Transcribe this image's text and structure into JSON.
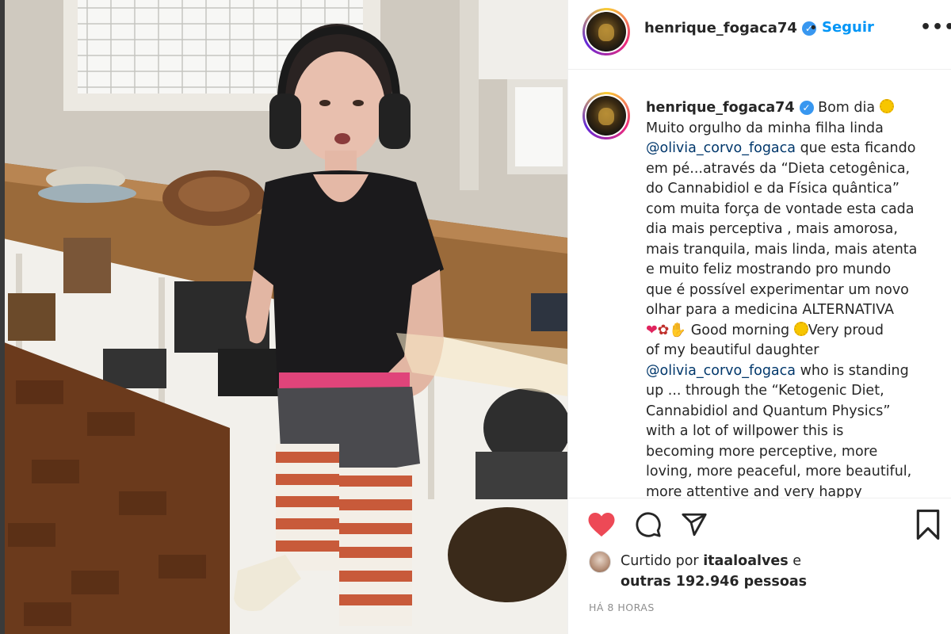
{
  "post": {
    "username": "henrique_fogaca74",
    "follow_label": "Seguir",
    "separator": "•",
    "more_label": "•••"
  },
  "caption": {
    "username": "henrique_fogaca74",
    "lines": [
      " Bom dia ",
      "Muito orgulho da minha filha linda",
      "@olivia_corvo_fogaca",
      " que esta ficando",
      "em pé...através da “Dieta cetogênica,",
      "do Cannabidiol e da Física quântica”",
      "com muita força de vontade esta cada",
      "dia mais perceptiva , mais amorosa,",
      "mais tranquila, mais linda, mais atenta",
      "e muito feliz mostrando pro mundo",
      "que é possível experimentar um novo",
      "olhar para a medicina ALTERNATIVA",
      " Good morning ",
      "Very proud",
      "of my beautiful daughter",
      "@olivia_corvo_fogaca",
      " who is standing",
      "up ... through the “Ketogenic Diet,",
      "Cannabidiol and Quantum Physics”",
      "with a lot of willpower this is",
      "becoming more perceptive, more",
      "loving, more peaceful, more beautiful,",
      "more attentive and very happy"
    ]
  },
  "likes": {
    "prefix": "Curtido por ",
    "user": "itaaloalves",
    "suffix": " e",
    "others": "outras 192.946 pessoas"
  },
  "timestamp": "HÁ 8 HORAS",
  "icons": [
    "verified-badge-icon",
    "heart-icon",
    "comment-icon",
    "share-icon",
    "bookmark-icon"
  ],
  "colors": {
    "link": "#0095f6",
    "verified": "#3897f0",
    "heart": "#ed4956",
    "mention": "#00376b"
  }
}
